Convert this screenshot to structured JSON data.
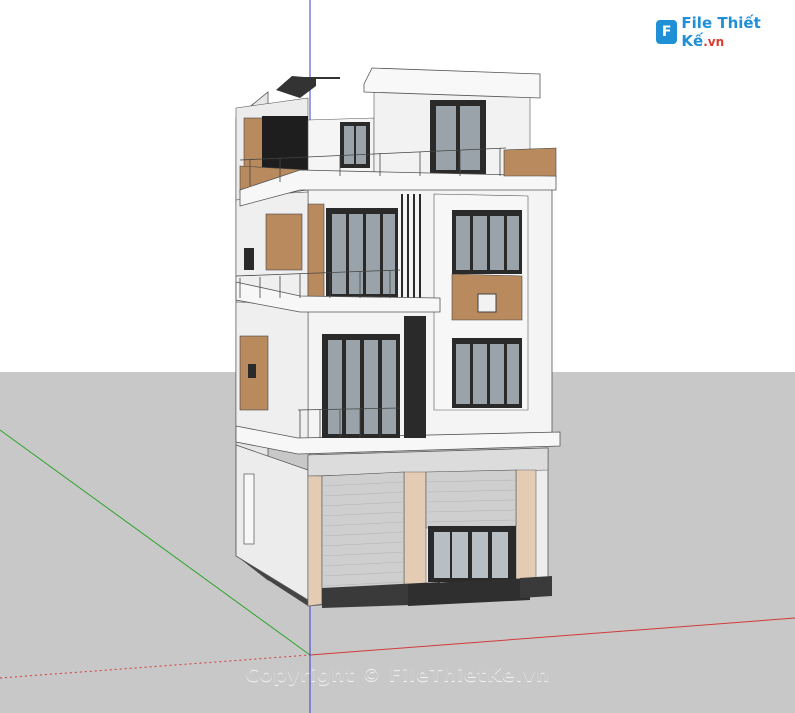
{
  "logo": {
    "mark": "F",
    "text": "File Thiết Kế",
    "ext": ".vn"
  },
  "watermark": "Copyright © FileThietKe.vn",
  "colors": {
    "sky": "#ffffff",
    "ground": "#c8c8c8",
    "wall": "#f3f3f3",
    "wall_shadow": "#dcdcdc",
    "wood": "#b98a5e",
    "stone": "#e3cbb4",
    "glass": "#9aa3a9",
    "frame": "#2a2a2a",
    "axis_red": "#d23a3a",
    "axis_green": "#2ca52c",
    "axis_blue": "#3a3ad2"
  }
}
